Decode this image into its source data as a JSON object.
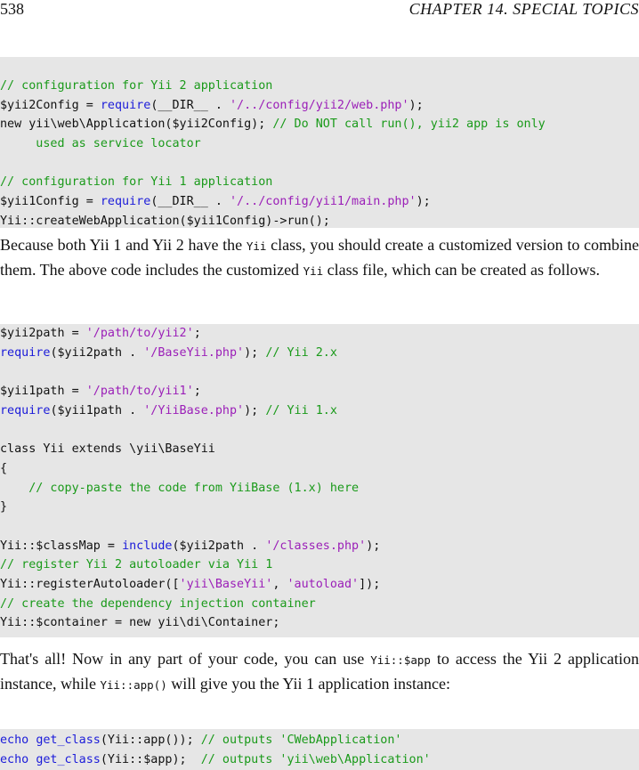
{
  "header": {
    "page_number": "538",
    "chapter_title": "CHAPTER 14.  SPECIAL TOPICS"
  },
  "block1": [
    [
      [
        "c",
        "// configuration for Yii 2 application"
      ]
    ],
    [
      [
        "p",
        "$yii2Config = "
      ],
      [
        "k",
        "require"
      ],
      [
        "p",
        "(__DIR__ . "
      ],
      [
        "s",
        "'/../config/yii2/web.php'"
      ],
      [
        "p",
        ");"
      ]
    ],
    [
      [
        "p",
        "new yii\\web\\Application($yii2Config); "
      ],
      [
        "c",
        "// Do NOT call run(), yii2 app is only"
      ]
    ],
    [
      [
        "c",
        "     used as service locator"
      ]
    ],
    [
      [
        "p",
        ""
      ]
    ],
    [
      [
        "c",
        "// configuration for Yii 1 application"
      ]
    ],
    [
      [
        "p",
        "$yii1Config = "
      ],
      [
        "k",
        "require"
      ],
      [
        "p",
        "(__DIR__ . "
      ],
      [
        "s",
        "'/../config/yii1/main.php'"
      ],
      [
        "p",
        ");"
      ]
    ],
    [
      [
        "p",
        "Yii::createWebApplication($yii1Config)->run();"
      ]
    ]
  ],
  "para1": [
    [
      "t",
      "Because both Yii 1 and Yii 2 have the "
    ],
    [
      "m",
      "Yii"
    ],
    [
      "t",
      " class, you should create a customized version to combine them. The above code includes the customized "
    ],
    [
      "m",
      "Yii"
    ],
    [
      "t",
      " class file, which can be created as follows."
    ]
  ],
  "block2": [
    [
      [
        "p",
        "$yii2path = "
      ],
      [
        "s",
        "'/path/to/yii2'"
      ],
      [
        "p",
        ";"
      ]
    ],
    [
      [
        "k",
        "require"
      ],
      [
        "p",
        "($yii2path . "
      ],
      [
        "s",
        "'/BaseYii.php'"
      ],
      [
        "p",
        "); "
      ],
      [
        "c",
        "// Yii 2.x"
      ]
    ],
    [
      [
        "p",
        ""
      ]
    ],
    [
      [
        "p",
        "$yii1path = "
      ],
      [
        "s",
        "'/path/to/yii1'"
      ],
      [
        "p",
        ";"
      ]
    ],
    [
      [
        "k",
        "require"
      ],
      [
        "p",
        "($yii1path . "
      ],
      [
        "s",
        "'/YiiBase.php'"
      ],
      [
        "p",
        "); "
      ],
      [
        "c",
        "// Yii 1.x"
      ]
    ],
    [
      [
        "p",
        ""
      ]
    ],
    [
      [
        "p",
        "class Yii extends \\yii\\BaseYii"
      ]
    ],
    [
      [
        "p",
        "{"
      ]
    ],
    [
      [
        "p",
        "    "
      ],
      [
        "c",
        "// copy-paste the code from YiiBase (1.x) here"
      ]
    ],
    [
      [
        "p",
        "}"
      ]
    ],
    [
      [
        "p",
        ""
      ]
    ],
    [
      [
        "p",
        "Yii::$classMap = "
      ],
      [
        "k",
        "include"
      ],
      [
        "p",
        "($yii2path . "
      ],
      [
        "s",
        "'/classes.php'"
      ],
      [
        "p",
        ");"
      ]
    ],
    [
      [
        "c",
        "// register Yii 2 autoloader via Yii 1"
      ]
    ],
    [
      [
        "p",
        "Yii::registerAutoloader(["
      ],
      [
        "s",
        "'yii\\BaseYii'"
      ],
      [
        "p",
        ", "
      ],
      [
        "s",
        "'autoload'"
      ],
      [
        "p",
        "]);"
      ]
    ],
    [
      [
        "c",
        "// create the dependency injection container"
      ]
    ],
    [
      [
        "p",
        "Yii::$container = new yii\\di\\Container;"
      ]
    ]
  ],
  "para2": [
    [
      "t",
      "That's all! Now in any part of your code, you can use "
    ],
    [
      "m",
      "Yii::$app"
    ],
    [
      "t",
      " to access the Yii 2 application instance, while "
    ],
    [
      "m",
      "Yii::app()"
    ],
    [
      "t",
      " will give you the Yii 1 application instance:"
    ]
  ],
  "block3": [
    [
      [
        "k",
        "echo"
      ],
      [
        "p",
        " "
      ],
      [
        "k",
        "get_class"
      ],
      [
        "p",
        "(Yii::app()); "
      ],
      [
        "c",
        "// outputs 'CWebApplication'"
      ]
    ],
    [
      [
        "k",
        "echo"
      ],
      [
        "p",
        " "
      ],
      [
        "k",
        "get_class"
      ],
      [
        "p",
        "(Yii::$app);  "
      ],
      [
        "c",
        "// outputs 'yii\\web\\Application'"
      ]
    ]
  ]
}
